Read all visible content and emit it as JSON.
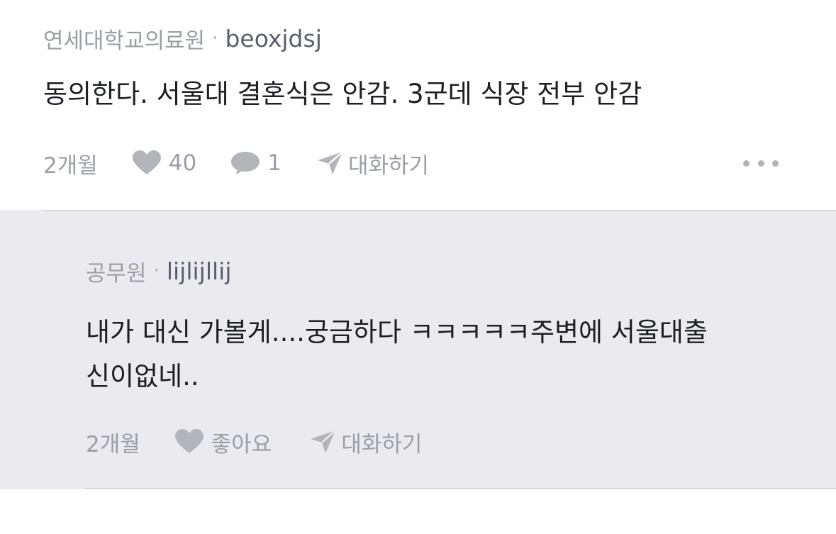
{
  "comment": {
    "org": "연세대학교의료원",
    "separator": "·",
    "username": "beoxjdsj",
    "body": "동의한다. 서울대 결혼식은 안감. 3군데 식장 전부 안감",
    "time": "2개월",
    "like_count": "40",
    "reply_count": "1",
    "chat_label": "대화하기",
    "icons": [
      "heart-icon",
      "speech-bubble-icon",
      "send-icon",
      "more-icon"
    ]
  },
  "reply": {
    "org": "공무원",
    "separator": "·",
    "username": "lijlijllij",
    "body_line1": "내가 대신 가볼게....궁금하다 ㅋㅋㅋㅋㅋ주변에 서울대출",
    "body_line2": "신이없네..",
    "time": "2개월",
    "like_label": "좋아요",
    "chat_label": "대화하기"
  },
  "colors": {
    "reply_background": "#ebebef",
    "muted_text": "#9b9ea6",
    "body_text": "#1d1f24",
    "icon_gray": "#b3b5bb"
  }
}
